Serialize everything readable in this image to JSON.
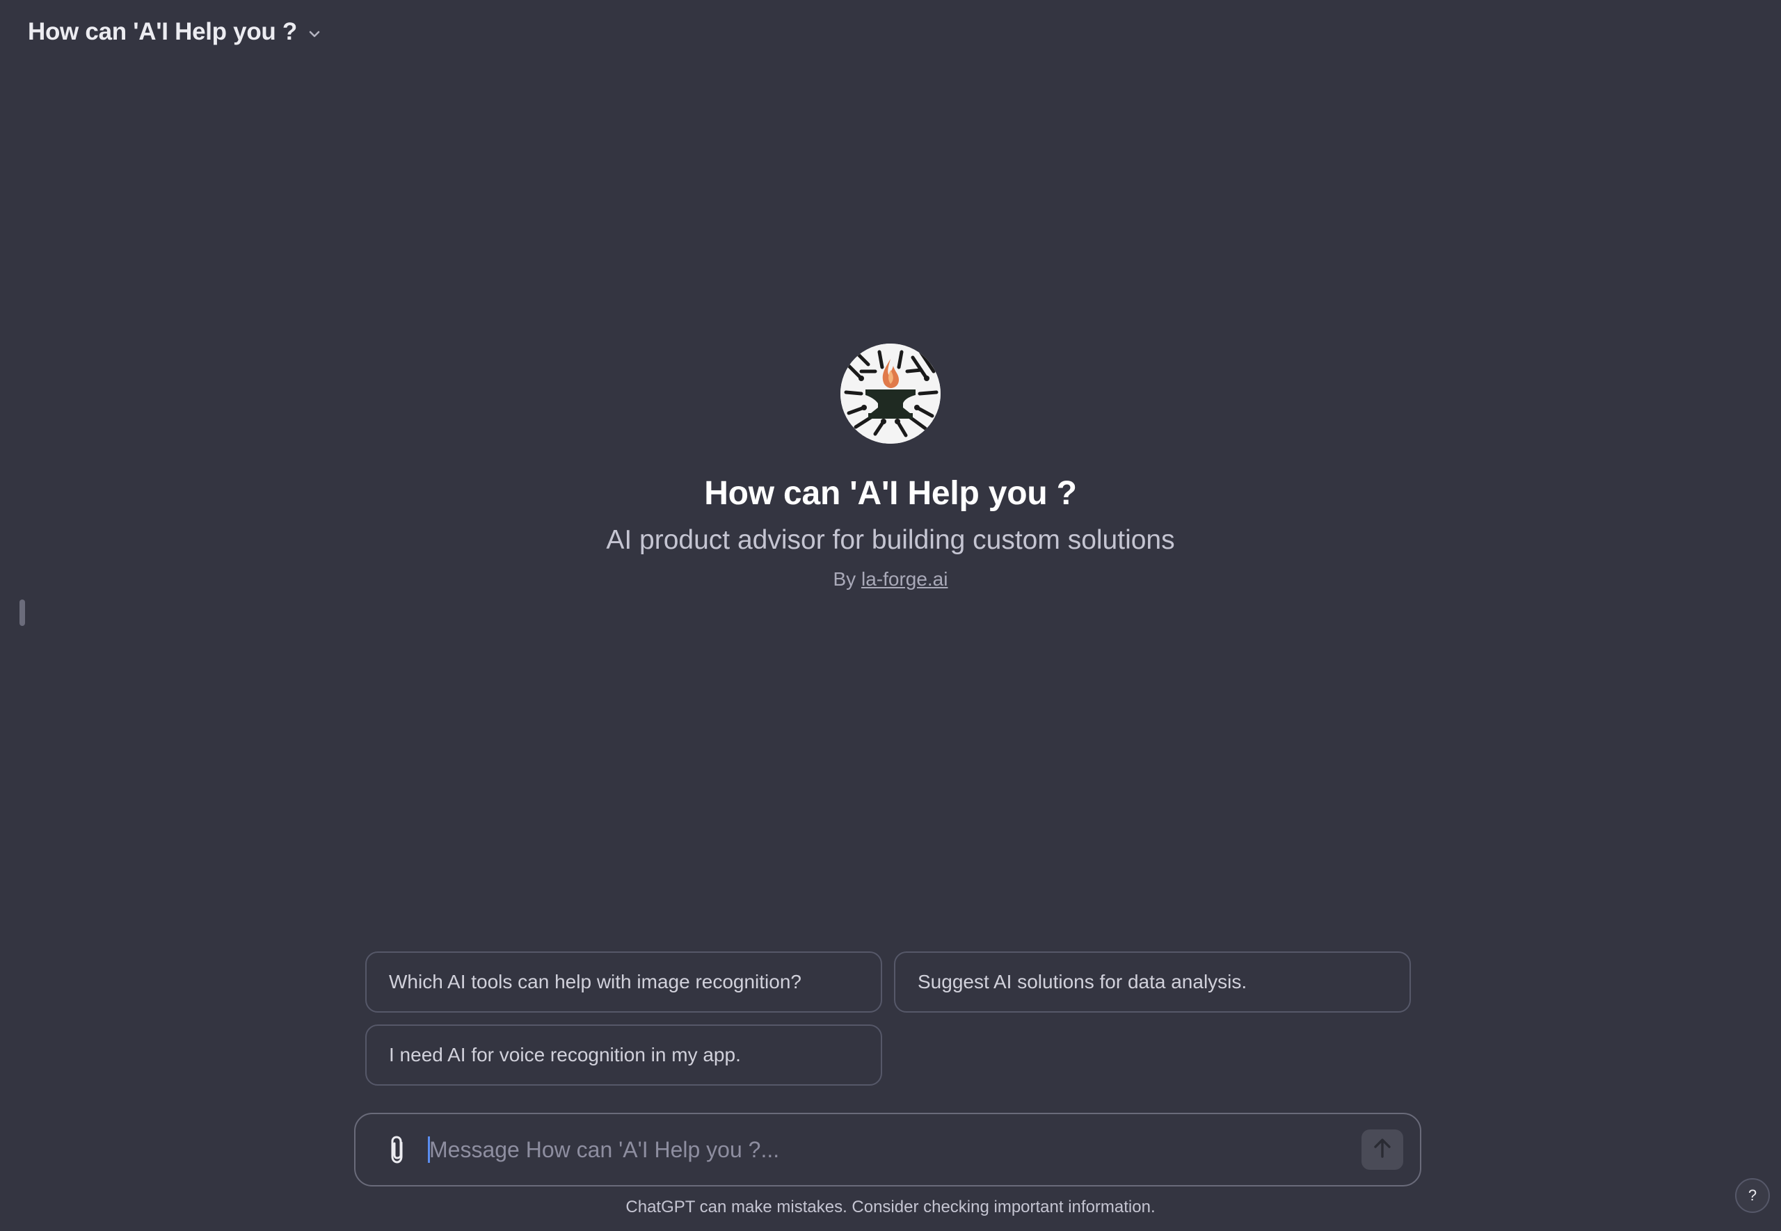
{
  "header": {
    "title": "How can 'A'I Help you ?",
    "dropdown_icon": "chevron-down-icon"
  },
  "hero": {
    "avatar_icon": "anvil-flame-logo",
    "title": "How can 'A'I Help you ?",
    "subtitle": "AI product advisor for building custom solutions",
    "by_prefix": "By",
    "author": "la-forge.ai"
  },
  "suggestions": [
    "Which AI tools can help with image recognition?",
    "Suggest AI solutions for data analysis.",
    "I need AI for voice recognition in my app."
  ],
  "composer": {
    "placeholder": "Message How can 'A'I Help you ?...",
    "value": "",
    "attach_icon": "paperclip-icon",
    "send_icon": "arrow-up-icon"
  },
  "footer": {
    "disclaimer": "ChatGPT can make mistakes. Consider checking important information.",
    "help_label": "?"
  },
  "colors": {
    "background": "#343541",
    "text": "#ECECF1",
    "border": "#565869",
    "caret": "#5B8DEF"
  }
}
